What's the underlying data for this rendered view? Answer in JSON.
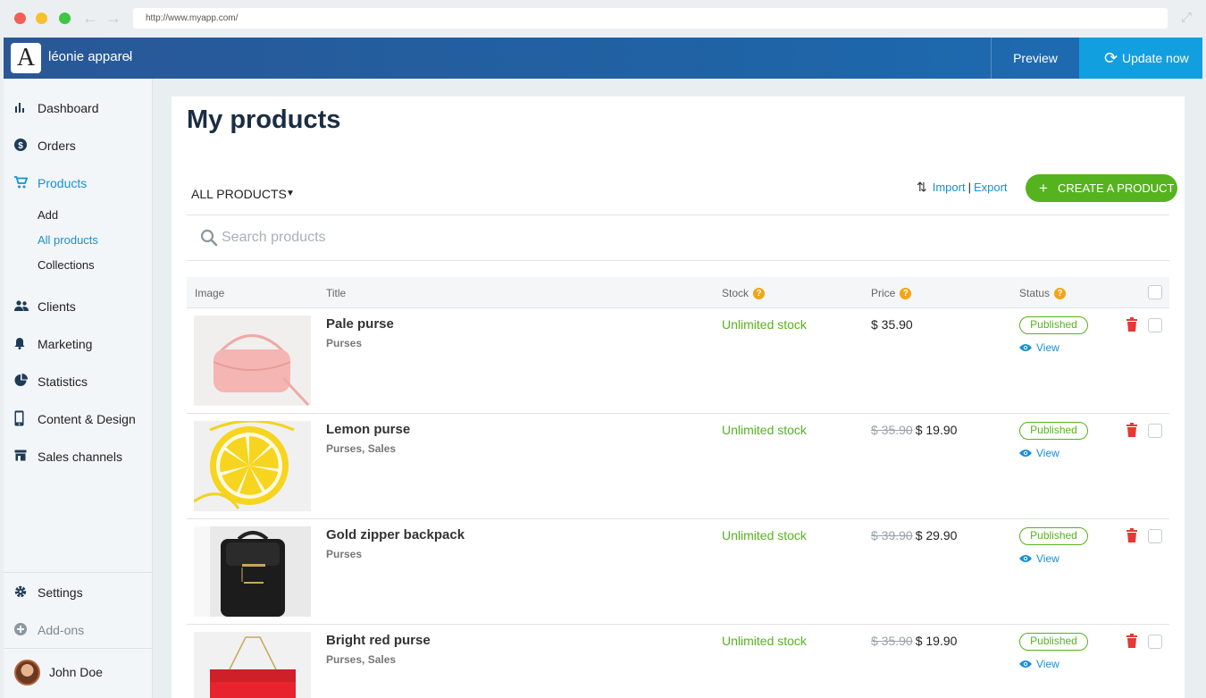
{
  "browser": {
    "url": "http://www.myapp.com/"
  },
  "header": {
    "logo_letter": "A",
    "store_name": "léonie apparel",
    "preview_label": "Preview",
    "update_label": "Update now"
  },
  "sidebar": {
    "items": [
      {
        "label": "Dashboard",
        "icon": "bar-chart-icon"
      },
      {
        "label": "Orders",
        "icon": "dollar-icon"
      },
      {
        "label": "Products",
        "icon": "cart-icon",
        "active": true
      },
      {
        "label": "Clients",
        "icon": "people-icon"
      },
      {
        "label": "Marketing",
        "icon": "bell-icon"
      },
      {
        "label": "Statistics",
        "icon": "pie-chart-icon"
      },
      {
        "label": "Content & Design",
        "icon": "phone-icon"
      },
      {
        "label": "Sales channels",
        "icon": "store-icon"
      }
    ],
    "sub_items": [
      {
        "label": "Add"
      },
      {
        "label": "All products",
        "active": true
      },
      {
        "label": "Collections"
      }
    ],
    "settings_label": "Settings",
    "addons_label": "Add-ons",
    "user_name": "John Doe"
  },
  "main": {
    "title": "My products",
    "filter_label": "ALL PRODUCTS",
    "import_label": "Import",
    "export_label": "Export",
    "create_label": "CREATE A PRODUCT",
    "search_placeholder": "Search products",
    "columns": {
      "image": "Image",
      "title": "Title",
      "stock": "Stock",
      "price": "Price",
      "status": "Status"
    },
    "products": [
      {
        "title": "Pale purse",
        "category": "Purses",
        "stock": "Unlimited stock",
        "old_price": "",
        "price": "$ 35.90",
        "status": "Published",
        "view": "View"
      },
      {
        "title": "Lemon purse",
        "category": "Purses, Sales",
        "stock": "Unlimited stock",
        "old_price": "$ 35.90",
        "price": "$ 19.90",
        "status": "Published",
        "view": "View"
      },
      {
        "title": "Gold zipper backpack",
        "category": "Purses",
        "stock": "Unlimited stock",
        "old_price": "$ 39.90",
        "price": "$ 29.90",
        "status": "Published",
        "view": "View"
      },
      {
        "title": "Bright red purse",
        "category": "Purses, Sales",
        "stock": "Unlimited stock",
        "old_price": "$ 35.90",
        "price": "$ 19.90",
        "status": "Published",
        "view": "View"
      }
    ]
  },
  "colors": {
    "brand": "#2a5796",
    "accent": "#1a8fd1",
    "success": "#55b31f",
    "danger": "#e53935",
    "help": "#f2a516"
  }
}
